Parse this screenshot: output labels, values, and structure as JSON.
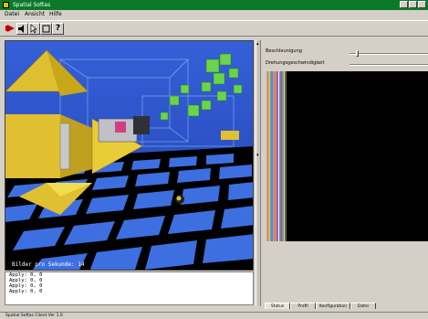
{
  "window": {
    "title": "Spatial Softas"
  },
  "menu": [
    "Datei",
    "Ansicht",
    "Hilfe"
  ],
  "toolbar": {
    "buttons": [
      "record-button",
      "speaker-button",
      "pointer-button",
      "frame-button",
      "help-button"
    ],
    "help_glyph": "?"
  },
  "viewport": {
    "fps_label": "Bilder pro Sekunde: 14"
  },
  "console": {
    "lines": [
      "Apply: 0, 0",
      "Apply: 0, 0",
      "Apply: 0, 0",
      "Apply: 0, 0"
    ]
  },
  "right_panel": {
    "brightness_label": "Beschleunigung",
    "speed_label": "Drehungsgeschwindigkeit",
    "brightness_value": 0.1,
    "tabs": [
      "Status",
      "Profil",
      "Konfiguration",
      "Datei"
    ]
  },
  "status": {
    "text": "Spatial Softas Client Ver 1.0"
  },
  "colors": {
    "title_bg": "#0a7a2a",
    "sky": "#2a56c8",
    "spectrum_bg": "#000000"
  }
}
